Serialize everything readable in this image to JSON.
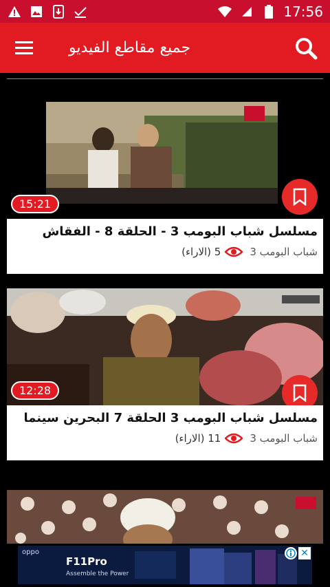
{
  "status_bar": {
    "time": "17:56",
    "icons_left": [
      "warning-icon",
      "image-icon",
      "download-icon",
      "check-icon"
    ],
    "icons_right": [
      "wifi-icon",
      "signal-icon",
      "battery-icon"
    ]
  },
  "app_bar": {
    "title": "جميع مقاطع الفيديو",
    "menu_icon": "menu-icon",
    "search_icon": "search-icon"
  },
  "videos": [
    {
      "duration": "15:21",
      "title": "مسلسل شباب البومب 3 - الحلقة 8 - الفقاش",
      "views": "5 (الاراء)",
      "channel": "شباب البومب 3"
    },
    {
      "duration": "12:28",
      "title": "مسلسل شباب البومب 3 الحلقة 7 البحرين سينما",
      "views": "11 (الاراء)",
      "channel": "شباب البومب 3"
    },
    {
      "duration": "",
      "title": "",
      "views": "",
      "channel": ""
    }
  ],
  "ad": {
    "brand": "oppo",
    "product": "F11Pro",
    "tagline": "Assemble the Power"
  },
  "colors": {
    "accent": "#e21b23",
    "status_bar": "#c8102e"
  }
}
